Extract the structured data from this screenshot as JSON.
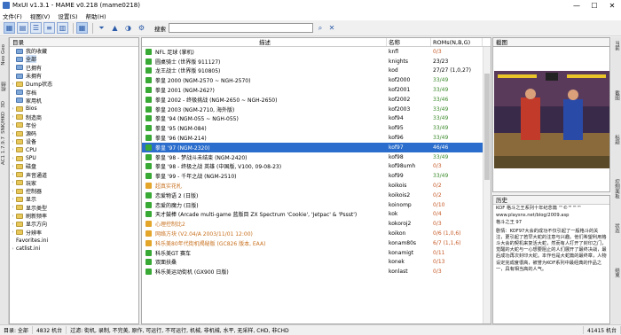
{
  "window": {
    "title": "MxUI v1.3.1 - MAME v0.218 (mame0218)",
    "controls": [
      "—",
      "☐",
      "✕"
    ]
  },
  "menu": [
    "文件(F)",
    "视图(V)",
    "设置(S)",
    "帮助(H)"
  ],
  "toolbar": {
    "search_label": "搜索",
    "search_value": ""
  },
  "left_strip": [
    "Neo Geo",
    "视频",
    "3D",
    "SNK/HKO",
    "AC1 1.7.9.7"
  ],
  "tree": {
    "header": "目录",
    "items": [
      {
        "label": "我的收藏",
        "blue": true,
        "exp": ""
      },
      {
        "label": "全部",
        "blue": true,
        "exp": "",
        "sel": true
      },
      {
        "label": "已拥有",
        "blue": true,
        "exp": ""
      },
      {
        "label": "未拥有",
        "blue": true,
        "exp": ""
      },
      {
        "label": "Dump状态",
        "blue": false,
        "exp": "›"
      },
      {
        "label": "存档",
        "blue": true,
        "exp": ""
      },
      {
        "label": "家用机",
        "blue": true,
        "exp": ""
      },
      {
        "label": "Bios",
        "blue": false,
        "exp": "›"
      },
      {
        "label": "制造商",
        "blue": false,
        "exp": "›"
      },
      {
        "label": "年份",
        "blue": false,
        "exp": "›"
      },
      {
        "label": "源码",
        "blue": false,
        "exp": "›"
      },
      {
        "label": "设备",
        "blue": false,
        "exp": "›"
      },
      {
        "label": "CPU",
        "blue": false,
        "exp": "›"
      },
      {
        "label": "SPU",
        "blue": false,
        "exp": "›"
      },
      {
        "label": "磁盘",
        "blue": false,
        "exp": "›"
      },
      {
        "label": "声音通道",
        "blue": false,
        "exp": "›"
      },
      {
        "label": "玩家",
        "blue": false,
        "exp": "›"
      },
      {
        "label": "控制器",
        "blue": false,
        "exp": "›"
      },
      {
        "label": "显示",
        "blue": false,
        "exp": "›"
      },
      {
        "label": "显示类型",
        "blue": false,
        "exp": "›"
      },
      {
        "label": "刷新频率",
        "blue": false,
        "exp": "›"
      },
      {
        "label": "显示方向",
        "blue": false,
        "exp": "›"
      },
      {
        "label": "分辨率",
        "blue": false,
        "exp": "›"
      },
      {
        "label": "Favorites.ini",
        "blue": false,
        "exp": "",
        "nofold": true
      },
      {
        "label": "catlist.ini",
        "blue": false,
        "exp": "›",
        "nofold": true
      }
    ]
  },
  "list": {
    "columns": [
      "描述",
      "名称",
      "ROMs(N,B,G)"
    ],
    "rows": [
      {
        "desc": "NFL 足球 (掌机)",
        "name": "knfl",
        "roms": "0/3",
        "status": "bad"
      },
      {
        "desc": "圆桌骑士 (世界版 911127)",
        "name": "knights",
        "roms": "23/23",
        "status": "ok0"
      },
      {
        "desc": "龙王战士 (世界版 910805)",
        "name": "kod",
        "roms": "27/27 (1,0,27)",
        "status": "ok0"
      },
      {
        "desc": "拳皇 2000 (NGM-2570 ~ NGH-2570)",
        "name": "kof2000",
        "roms": "33/49",
        "status": "ok"
      },
      {
        "desc": "拳皇 2001 (NGM-262?)",
        "name": "kof2001",
        "roms": "33/49",
        "status": "ok"
      },
      {
        "desc": "拳皇 2002 - 终极挑战 (NGM-2650 ~ NGH-2650)",
        "name": "kof2002",
        "roms": "33/46",
        "status": "ok"
      },
      {
        "desc": "拳皇 2003 (NGM-2710, 海外版)",
        "name": "kof2003",
        "roms": "33/49",
        "status": "ok"
      },
      {
        "desc": "拳皇 '94 (NGM-055 ~ NGH-055)",
        "name": "kof94",
        "roms": "33/49",
        "status": "ok"
      },
      {
        "desc": "拳皇 '95 (NGM-084)",
        "name": "kof95",
        "roms": "33/49",
        "status": "ok"
      },
      {
        "desc": "拳皇 '96 (NGM-214)",
        "name": "kof96",
        "roms": "33/49",
        "status": "ok"
      },
      {
        "desc": "拳皇 '97 (NGM-2320)",
        "name": "kof97",
        "roms": "46/46",
        "status": "sel"
      },
      {
        "desc": "拳皇 '98 - 梦战斗未结束 (NGM-2420)",
        "name": "kof98",
        "roms": "33/49",
        "status": "ok"
      },
      {
        "desc": "拳皇 '98 - 终极之战 英雄 (中国版, V100, 09-08-23)",
        "name": "kof98umh",
        "roms": "0/3",
        "status": "bad"
      },
      {
        "desc": "拳皇 '99 - 千年之战 (NGM-2510)",
        "name": "kof99",
        "roms": "33/49",
        "status": "ok"
      },
      {
        "desc": "超真实花札",
        "name": "koikois",
        "roms": "0/2",
        "status": "bad",
        "warn": true
      },
      {
        "desc": "恋爱物语 2 (日版)",
        "name": "koikois2",
        "roms": "0/2",
        "status": "bad"
      },
      {
        "desc": "恋爱的魔力 (日版)",
        "name": "koinomp",
        "roms": "0/10",
        "status": "bad"
      },
      {
        "desc": "天才鼓棒 (Arcade multi-game 蓝版目 ZX Spectrum 'Cookie', 'Jetpac' & 'Pssst')",
        "name": "kok",
        "roms": "0/4",
        "status": "bad"
      },
      {
        "desc": "心理控制比2",
        "name": "kokoroj2",
        "roms": "0/3",
        "status": "bad",
        "warn": true
      },
      {
        "desc": "网络方块 (V2.04/A 2003/11/01 12:00)",
        "name": "koikon",
        "roms": "0/6 (1,0,6)",
        "status": "bad",
        "warn": true
      },
      {
        "desc": "科乐美80年代街机揭秘版 (GC826 版本, EAA)",
        "name": "konam80s",
        "roms": "6/7 (1,1,6)",
        "status": "bad",
        "warn": true
      },
      {
        "desc": "科乐美GT 赛车",
        "name": "konamigt",
        "roms": "0/11",
        "status": "bad"
      },
      {
        "desc": "双面扶桑",
        "name": "konek",
        "roms": "0/13",
        "status": "bad"
      },
      {
        "desc": "科乐美运动街机 (GX900 日版)",
        "name": "konlast",
        "roms": "0/3",
        "status": "bad"
      }
    ]
  },
  "snap": {
    "header": "截图"
  },
  "history": {
    "header": "历史",
    "text": [
      "KOF 格斗之王系列十年纪念篇 ™©™™™",
      "www.playsns.net/blog/2009.asp",
      "格斗之王 97",
      "",
      "剧情：KOF97大会的成功不仅引起了一般格斗的关注，更引起了若罕大蛇的注意与兴趣。他们希望利用格斗大会的契机来复活大蛇，然而有人打开了封印之门，觉醒的大蛇与一心想要阻止的人们展开了最终决战，最后成功再次封印大蛇。本作也是大蛇篇的最终章，人物设定完成度很高，被誉为KOF系列中最经典的作品之一，具有相当高的人气。"
    ]
  },
  "right_strip": [
    "当前",
    "截图",
    "标题",
    "控制面板",
    "状态",
    "结束"
  ],
  "status": [
    "目录: 全部",
    "4832 机台",
    "过滤: 街机, 录制, 不完美, 原作, 可运行, 不可运行, 机械, 非机械, 水平, 无采样, CHD, 非CHD",
    "41415 机台"
  ]
}
